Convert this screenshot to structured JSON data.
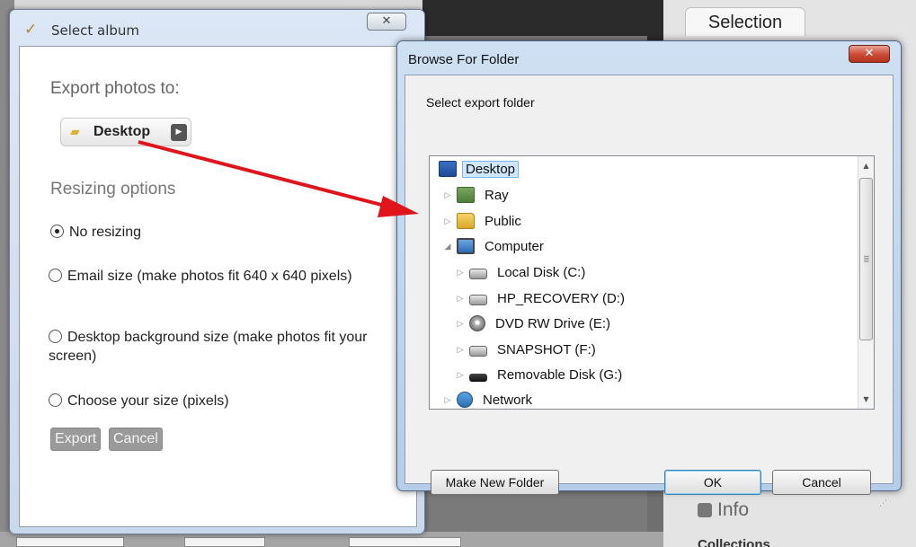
{
  "background": {
    "selection_tab": "Selection",
    "info_label": "Info",
    "collections_label": "Collections"
  },
  "album_window": {
    "title": "Select album",
    "close_glyph": "✕",
    "export_heading": "Export photos to:",
    "destination": "Desktop",
    "resizing_heading": "Resizing options",
    "options": [
      {
        "label": "No resizing",
        "selected": true
      },
      {
        "label": "Email size (make photos fit 640 x 640 pixels)",
        "selected": false
      },
      {
        "label": "Desktop background size (make photos fit your screen)",
        "selected": false
      },
      {
        "label": "Choose your size (pixels)",
        "selected": false
      }
    ],
    "export_button": "Export",
    "cancel_button": "Cancel"
  },
  "browse_dialog": {
    "title": "Browse For Folder",
    "close_glyph": "✕",
    "prompt": "Select export folder",
    "tree": [
      {
        "label": "Desktop",
        "icon": "desktop-icon",
        "level": 0,
        "expander": "",
        "selected": true
      },
      {
        "label": "Ray",
        "icon": "user-folder-icon",
        "level": 1,
        "expander": "▷"
      },
      {
        "label": "Public",
        "icon": "folder-icon",
        "level": 1,
        "expander": "▷"
      },
      {
        "label": "Computer",
        "icon": "computer-icon",
        "level": 1,
        "expander": "◢"
      },
      {
        "label": "Local Disk (C:)",
        "icon": "local-disk-icon",
        "level": 2,
        "expander": "▷"
      },
      {
        "label": "HP_RECOVERY (D:)",
        "icon": "drive-icon",
        "level": 2,
        "expander": "▷"
      },
      {
        "label": "DVD RW Drive (E:)",
        "icon": "dvd-drive-icon",
        "level": 2,
        "expander": "▷"
      },
      {
        "label": "SNAPSHOT (F:)",
        "icon": "drive-icon",
        "level": 2,
        "expander": "▷"
      },
      {
        "label": "Removable Disk (G:)",
        "icon": "removable-disk-icon",
        "level": 2,
        "expander": "▷"
      },
      {
        "label": "Network",
        "icon": "network-icon",
        "level": 1,
        "expander": "▷"
      }
    ],
    "make_new_folder_button": "Make New Folder",
    "ok_button": "OK",
    "cancel_button": "Cancel"
  },
  "colors": {
    "annotation_arrow": "#e0141b",
    "dialog_frame": "#b5cde8",
    "close_button": "#c94a34"
  }
}
